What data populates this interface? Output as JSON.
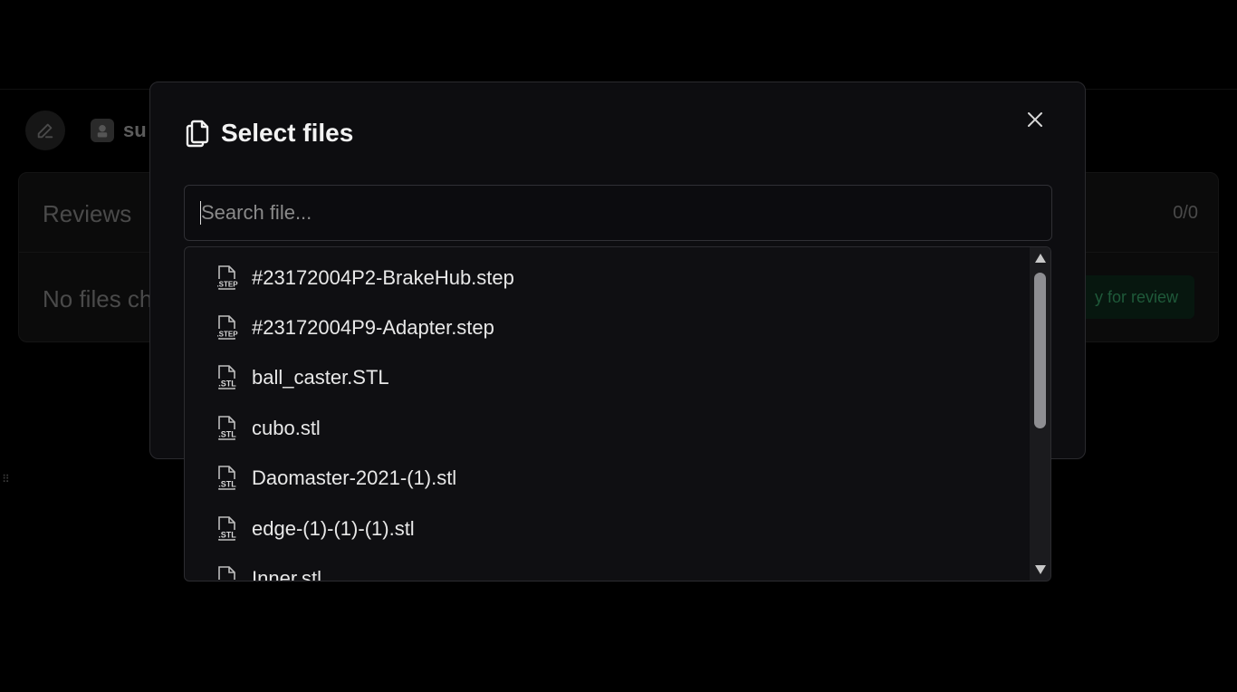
{
  "background": {
    "user_name": "su",
    "reviews_title": "Reviews",
    "reviews_count": "0/0",
    "no_files_text": "No files ch",
    "ready_button": "y for review"
  },
  "modal": {
    "title": "Select files",
    "search_placeholder": "Search file...",
    "search_value": "",
    "files": [
      {
        "name": "#23172004P2-BrakeHub.step",
        "type": "STEP"
      },
      {
        "name": "#23172004P9-Adapter.step",
        "type": "STEP"
      },
      {
        "name": "ball_caster.STL",
        "type": "STL"
      },
      {
        "name": "cubo.stl",
        "type": "STL"
      },
      {
        "name": "Daomaster-2021-(1).stl",
        "type": "STL"
      },
      {
        "name": "edge-(1)-(1)-(1).stl",
        "type": "STL"
      },
      {
        "name": "Inner.stl",
        "type": "STL"
      }
    ]
  },
  "icons": {
    "edit": "pencil-icon",
    "avatar": "user-avatar-icon",
    "title": "copy-files-icon",
    "close": "close-icon",
    "file": "file-type-icon",
    "scroll_up": "triangle-up-icon",
    "scroll_down": "triangle-down-icon"
  },
  "colors": {
    "accent_green": "#1f5a3a",
    "modal_bg": "#0d0d10",
    "scroll_thumb": "#8e8e92"
  }
}
